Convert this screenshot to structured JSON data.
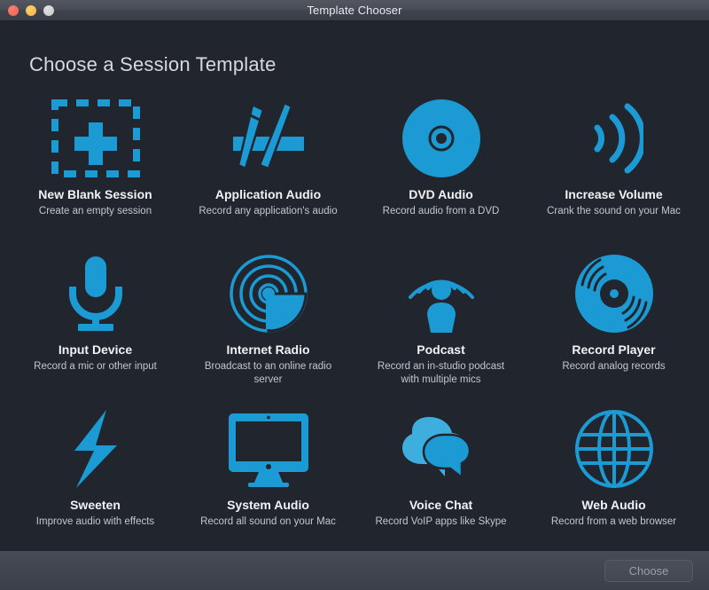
{
  "window": {
    "title": "Template Chooser",
    "traffic_lights": [
      {
        "name": "close",
        "color": "#ec6a5e"
      },
      {
        "name": "minimize",
        "color": "#f3bc4f"
      },
      {
        "name": "zoom",
        "color": "#cfcfcf"
      }
    ]
  },
  "heading": "Choose a Session Template",
  "colors": {
    "accent": "#1b9ad4",
    "background": "#21252e",
    "titlebar": "#474c56",
    "footer": "#414650",
    "title_text": "#f1f2f4",
    "desc_text": "#c3c7ce"
  },
  "templates": [
    {
      "icon": "dashed-plus-icon",
      "title": "New Blank Session",
      "desc": "Create an empty session"
    },
    {
      "icon": "app-store-icon",
      "title": "Application Audio",
      "desc": "Record any application's audio"
    },
    {
      "icon": "dvd-disc-icon",
      "title": "DVD Audio",
      "desc": "Record audio from a DVD"
    },
    {
      "icon": "volume-waves-icon",
      "title": "Increase Volume",
      "desc": "Crank the sound on your Mac"
    },
    {
      "icon": "microphone-icon",
      "title": "Input Device",
      "desc": "Record a mic or other input"
    },
    {
      "icon": "satellite-dish-icon",
      "title": "Internet Radio",
      "desc": "Broadcast to an online radio server"
    },
    {
      "icon": "podcast-person-icon",
      "title": "Podcast",
      "desc": "Record an in-studio podcast with multiple mics"
    },
    {
      "icon": "vinyl-record-icon",
      "title": "Record Player",
      "desc": "Record analog records"
    },
    {
      "icon": "lightning-bolt-icon",
      "title": "Sweeten",
      "desc": "Improve audio with effects"
    },
    {
      "icon": "imac-display-icon",
      "title": "System Audio",
      "desc": "Record all sound on your Mac"
    },
    {
      "icon": "speech-bubbles-icon",
      "title": "Voice Chat",
      "desc": "Record VoIP apps like Skype"
    },
    {
      "icon": "globe-icon",
      "title": "Web Audio",
      "desc": "Record from a web browser"
    }
  ],
  "footer": {
    "choose_label": "Choose",
    "choose_enabled": false
  }
}
